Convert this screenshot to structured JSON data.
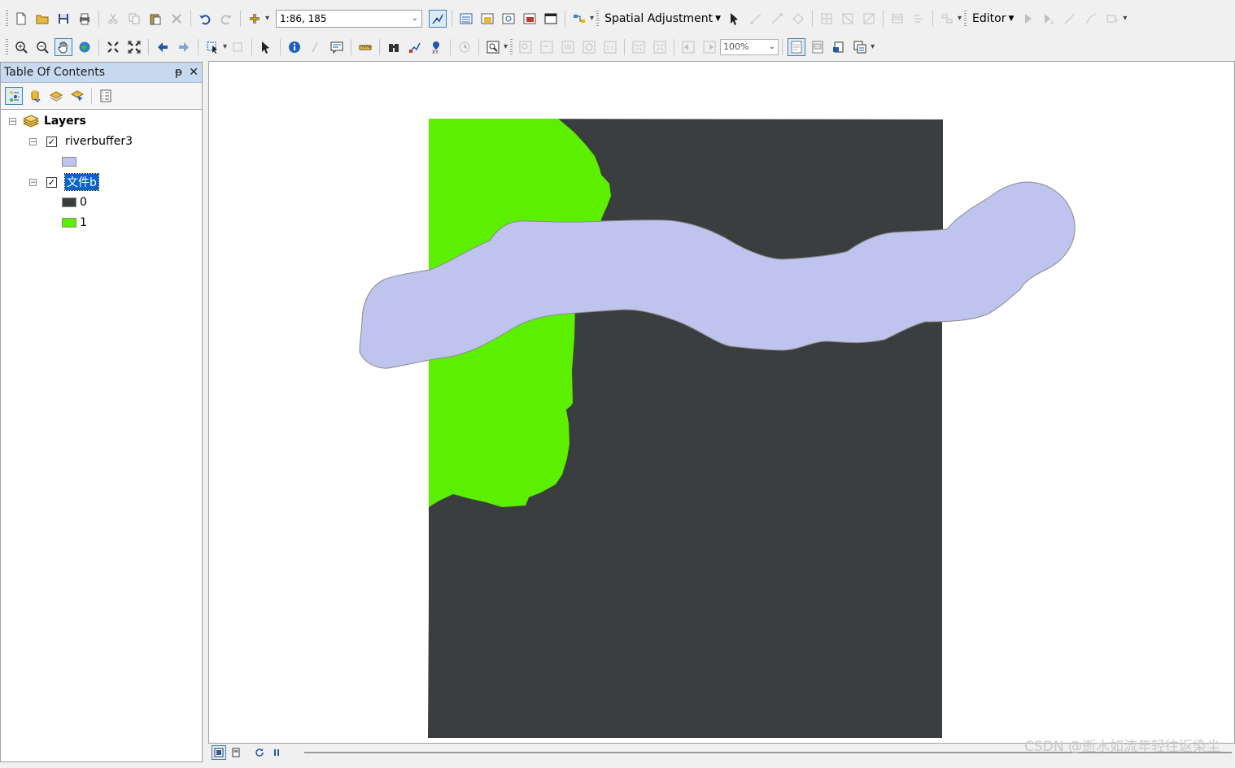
{
  "toolbar_top": {
    "scale_value": "1:86, 185",
    "spatial_adjustment_label": "Spatial Adjustment",
    "editor_label": "Editor"
  },
  "toolbar_nav": {
    "zoom_percent": "100%"
  },
  "toc": {
    "title": "Table Of Contents",
    "root_label": "Layers",
    "layers": [
      {
        "name": "riverbuffer3",
        "checked": true,
        "symbols": [
          {
            "label": "",
            "color": "#bec4ee"
          }
        ]
      },
      {
        "name": "文件b",
        "checked": true,
        "selected": true,
        "symbols": [
          {
            "label": "0",
            "color": "#3a3e3e"
          },
          {
            "label": "1",
            "color": "#5cf000"
          }
        ]
      }
    ]
  },
  "map": {
    "raster_colors": {
      "class_0": "#3a3e3e",
      "class_1": "#5cf000"
    },
    "buffer_color": "#bec4ee",
    "buffer_outline": "#8a8a8a"
  },
  "watermark": "CSDN @逝水如流年轻往返染尘"
}
